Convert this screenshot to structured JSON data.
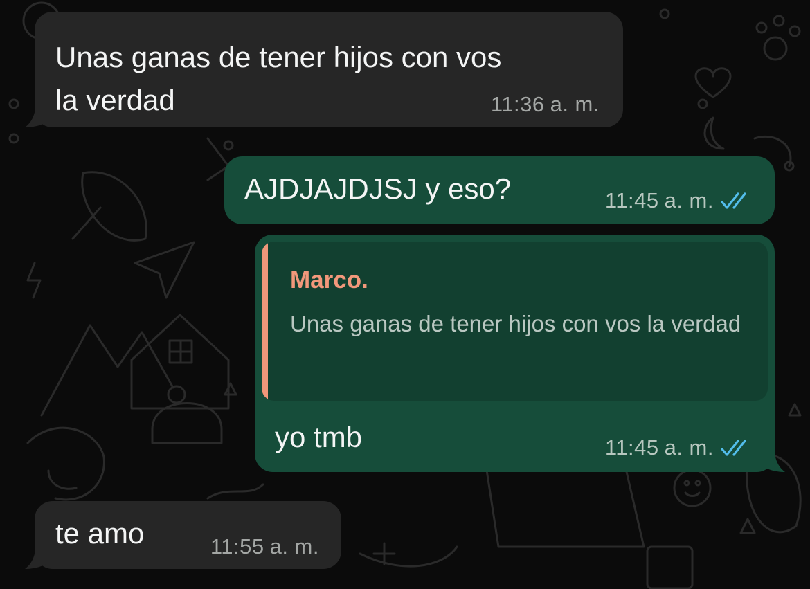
{
  "colors": {
    "background": "#0b0b0b",
    "incoming_bubble": "#262626",
    "outgoing_bubble": "#164d3a",
    "quote_background": "#124030",
    "quote_accent": "#f0977a",
    "read_receipt": "#53bdeb"
  },
  "messages": [
    {
      "direction": "incoming",
      "lines": [
        "Unas ganas de tener hijos con vos",
        "la verdad"
      ],
      "time": "11:36",
      "period": "a. m."
    },
    {
      "direction": "outgoing",
      "text": "AJDJAJDJSJ y eso?",
      "time": "11:45",
      "period": "a. m.",
      "status_icon": "double-check-icon"
    },
    {
      "direction": "outgoing",
      "reply": {
        "author": "Marco.",
        "text": "Unas ganas de tener hijos con vos la verdad"
      },
      "text": "yo tmb",
      "time": "11:45",
      "period": "a. m.",
      "status_icon": "double-check-icon"
    },
    {
      "direction": "incoming",
      "text": "te amo",
      "time": "11:55",
      "period": "a. m."
    }
  ]
}
